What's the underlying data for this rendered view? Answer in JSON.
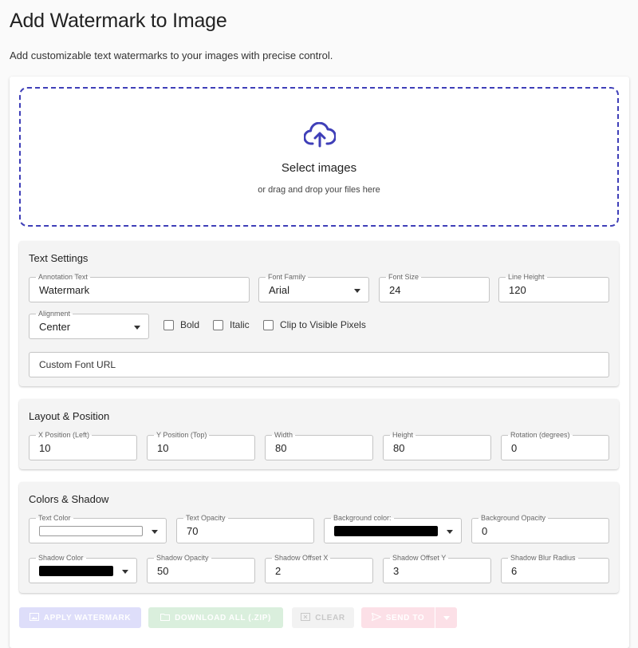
{
  "page": {
    "title": "Add Watermark to Image",
    "subtitle": "Add customizable text watermarks to your images with precise control."
  },
  "dropzone": {
    "title": "Select images",
    "subtitle": "or drag and drop your files here",
    "icon": "cloud-upload-icon",
    "accent": "#3f3fb8"
  },
  "text_settings": {
    "title": "Text Settings",
    "annotation_text": {
      "label": "Annotation Text",
      "value": "Watermark"
    },
    "font_family": {
      "label": "Font Family",
      "value": "Arial"
    },
    "font_size": {
      "label": "Font Size",
      "value": "24"
    },
    "line_height": {
      "label": "Line Height",
      "value": "120"
    },
    "alignment": {
      "label": "Alignment",
      "value": "Center"
    },
    "bold_label": "Bold",
    "italic_label": "Italic",
    "clip_label": "Clip to Visible Pixels",
    "custom_font_url": {
      "placeholder": "Custom Font URL",
      "value": ""
    }
  },
  "layout_position": {
    "title": "Layout & Position",
    "x_position": {
      "label": "X Position (Left)",
      "value": "10"
    },
    "y_position": {
      "label": "Y Position (Top)",
      "value": "10"
    },
    "width": {
      "label": "Width",
      "value": "80"
    },
    "height": {
      "label": "Height",
      "value": "80"
    },
    "rotation": {
      "label": "Rotation (degrees)",
      "value": "0"
    }
  },
  "colors_shadow": {
    "title": "Colors & Shadow",
    "text_color": {
      "label": "Text Color",
      "color": "#ffffff"
    },
    "text_opacity": {
      "label": "Text Opacity",
      "value": "70"
    },
    "background_color": {
      "label": "Background color:",
      "color": "#000000"
    },
    "background_opacity": {
      "label": "Background Opacity",
      "value": "0"
    },
    "shadow_color": {
      "label": "Shadow Color",
      "color": "#000000"
    },
    "shadow_opacity": {
      "label": "Shadow Opacity",
      "value": "50"
    },
    "shadow_offset_x": {
      "label": "Shadow Offset X",
      "value": "2"
    },
    "shadow_offset_y": {
      "label": "Shadow Offset Y",
      "value": "3"
    },
    "shadow_blur": {
      "label": "Shadow Blur Radius",
      "value": "6"
    }
  },
  "actions": {
    "apply": {
      "label": "APPLY WATERMARK",
      "icon": "image-icon",
      "color": "#9c9cf0"
    },
    "download": {
      "label": "DOWNLOAD ALL (.ZIP)",
      "icon": "folder-icon",
      "color": "#8fcf98"
    },
    "clear": {
      "label": "CLEAR",
      "icon": "clear-icon",
      "color": "#c8c8c8"
    },
    "send_to": {
      "label": "SEND TO",
      "icon": "send-icon",
      "color": "#f7a3b7"
    }
  }
}
